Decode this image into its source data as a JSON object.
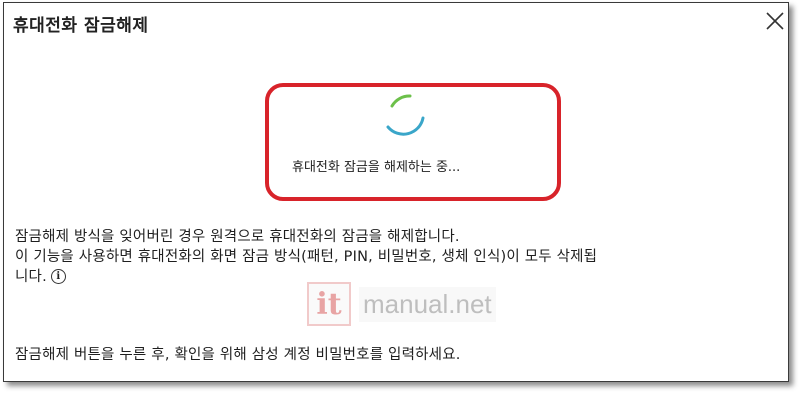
{
  "dialog": {
    "title": "휴대전화 잠금해제",
    "close_icon": "close-icon"
  },
  "loading": {
    "text": "휴대전화 잠금을 해제하는 중..."
  },
  "description": {
    "line1": "잠금해제 방식을 잊어버린 경우 원격으로 휴대전화의 잠금을 해제합니다.",
    "line2": "이 기능을 사용하면 휴대전화의 화면 잠금 방식(패턴, PIN, 비밀번호, 생체 인식)이 모두 삭제됩",
    "line3": "니다.",
    "info_icon_glyph": "i",
    "instruction": "잠금해제 버튼을 누른 후, 확인을 위해 삼성 계정 비밀번호를 입력하세요."
  },
  "watermark": {
    "badge": "it",
    "text": "manual.net"
  },
  "colors": {
    "highlight": "#d8232a",
    "spinner_green": "#6cc04a",
    "spinner_blue": "#3aa6c9"
  }
}
